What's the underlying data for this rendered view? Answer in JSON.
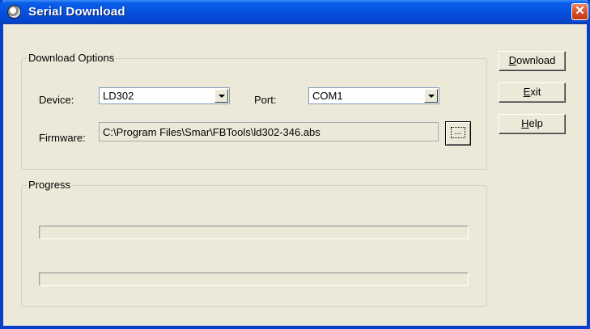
{
  "window": {
    "title": "Serial Download",
    "close_glyph": "✕"
  },
  "download_options": {
    "group_title": "Download Options",
    "device_label": "Device:",
    "device_value": "LD302",
    "port_label": "Port:",
    "port_value": "COM1",
    "firmware_label": "Firmware:",
    "firmware_value": "C:\\Program Files\\Smar\\FBTools\\ld302-346.abs",
    "browse_label": "..."
  },
  "progress": {
    "group_title": "Progress",
    "bar1_fraction": 0,
    "bar2_fraction": 0
  },
  "buttons": {
    "download_mnemonic": "D",
    "download_rest": "ownload",
    "exit_mnemonic": "E",
    "exit_rest": "xit",
    "help_mnemonic": "H",
    "help_rest": "elp"
  },
  "icons": {
    "app": "gear-disk-icon",
    "combo_arrow": "chevron-down-icon"
  },
  "colors": {
    "titlebar": "#0550E0",
    "close": "#D84B26",
    "face": "#ECE9D8"
  }
}
